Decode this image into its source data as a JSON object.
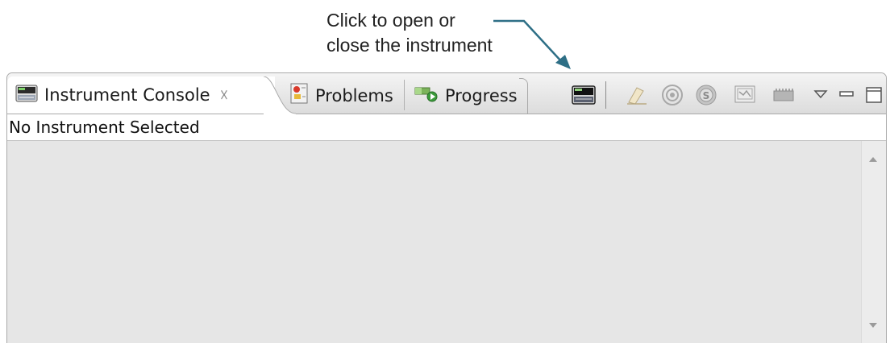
{
  "annotation": {
    "line1": "Click to open or",
    "line2": "close the instrument"
  },
  "tabs": [
    {
      "label": "Instrument Console",
      "icon": "instrument-console-icon",
      "active": true,
      "close_glyph": "☓"
    },
    {
      "label": "Problems",
      "icon": "problems-icon"
    },
    {
      "label": "Progress",
      "icon": "progress-icon"
    }
  ],
  "toolbar": {
    "items": [
      "instrument-toggle-icon",
      "clear-console-icon",
      "connect-icon",
      "stop-icon",
      "display-icon",
      "memory-icon",
      "view-menu-icon",
      "minimize-icon",
      "maximize-icon"
    ]
  },
  "status": {
    "text": "No Instrument Selected"
  },
  "colors": {
    "arrow": "#2e6f86",
    "tab_bg": "#e0e0e0",
    "console_bg": "#e6e6e6"
  }
}
